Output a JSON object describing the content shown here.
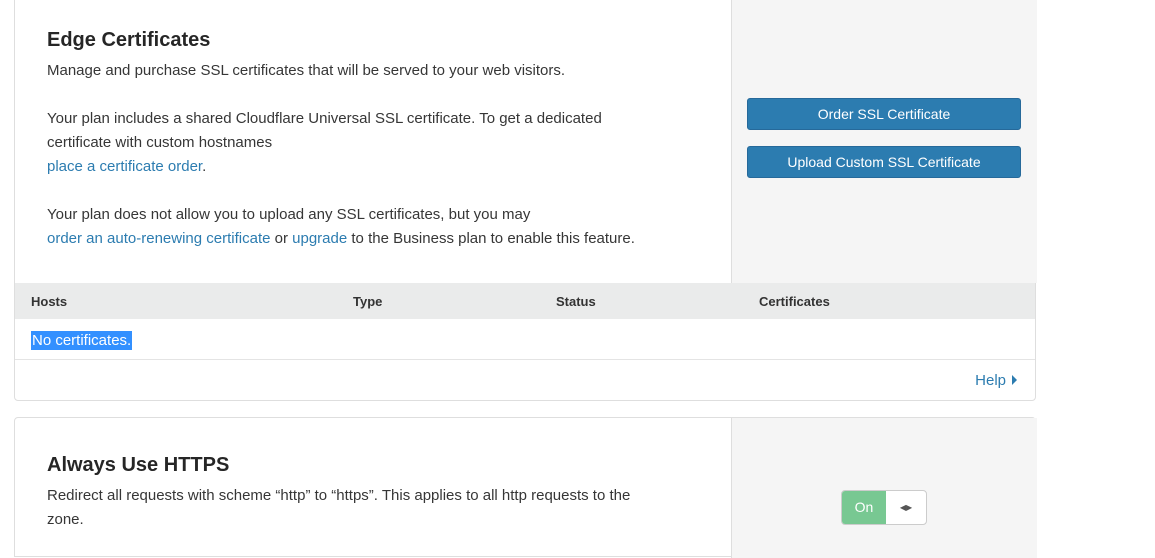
{
  "edge": {
    "title": "Edge Certificates",
    "description": "Manage and purchase SSL certificates that will be served to your web visitors.",
    "plan_text_1": "Your plan includes a shared Cloudflare Universal SSL certificate. To get a dedicated",
    "plan_text_2": "certificate with custom hostnames",
    "order_link": "place a certificate order",
    "order_link_suffix": ".",
    "upload_text_1": "Your plan does not allow you to upload any SSL certificates, but you may",
    "auto_renew_link": "order an auto-renewing certificate",
    "or_text": " or ",
    "upgrade_link": "upgrade",
    "upgrade_suffix": " to the Business plan to enable this feature.",
    "order_button": "Order SSL Certificate",
    "upload_button": "Upload Custom SSL Certificate",
    "table": {
      "columns": [
        "Hosts",
        "Type",
        "Status",
        "Certificates"
      ],
      "empty_text": "No certificates."
    },
    "help_label": "Help"
  },
  "https": {
    "title": "Always Use HTTPS",
    "description_1": "Redirect all requests with scheme “http” to “https”. This applies to all http requests to the",
    "description_2": "zone.",
    "toggle_state": "On"
  },
  "colors": {
    "link": "#2c7cb0",
    "button": "#2c7cb0",
    "toggle_on": "#78c892",
    "selection": "#3390ff"
  }
}
